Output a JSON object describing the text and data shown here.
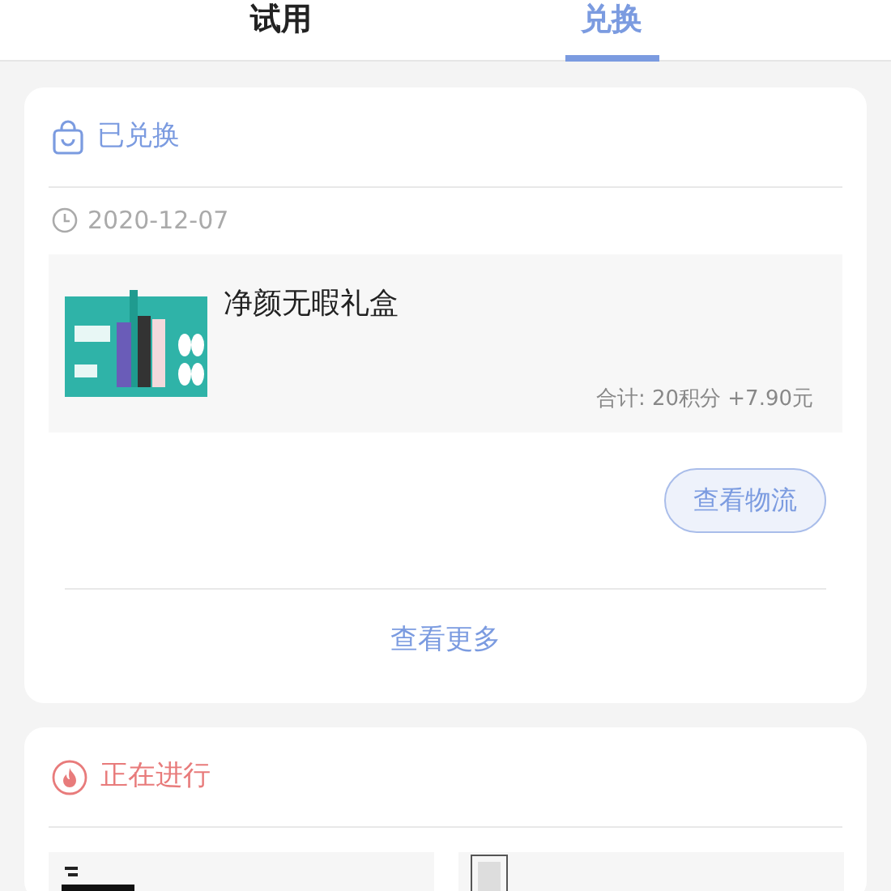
{
  "tabs": [
    {
      "label": "试用",
      "selected": false
    },
    {
      "label": "兑换",
      "selected": true
    }
  ],
  "sections": [
    {
      "kind": "exchanged",
      "title": "已兑换",
      "date": "2020-12-07",
      "product": {
        "name": "净颜无暇礼盒",
        "total": "合计: 20积分 +7.90元"
      },
      "action": "查看物流",
      "more": "查看更多"
    },
    {
      "kind": "ongoing",
      "title": "正在进行"
    }
  ]
}
